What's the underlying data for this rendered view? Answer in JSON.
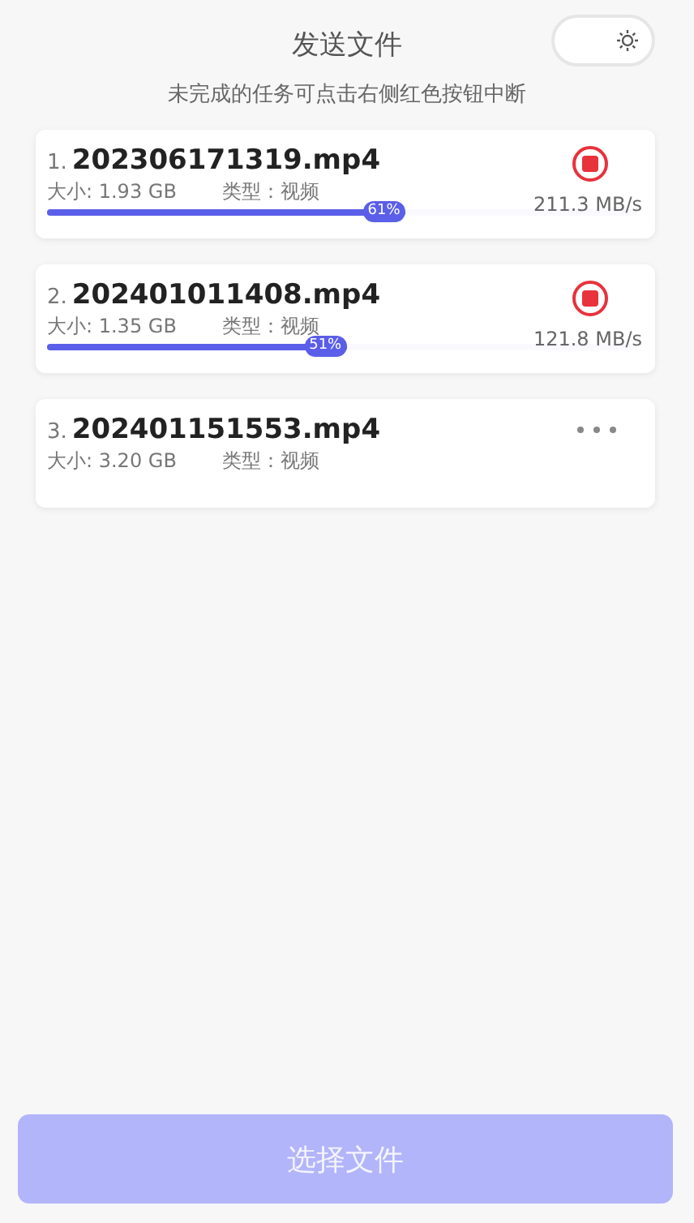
{
  "header": {
    "title": "发送文件",
    "hint": "未完成的任务可点击右侧红色按钮中断",
    "theme_toggle": {
      "on": false
    }
  },
  "files": [
    {
      "index": "1.",
      "name": "202306171319.mp4",
      "size": "大小: 1.93 GB",
      "type": "类型：视频",
      "kind": "sending",
      "level": 0.61,
      "percent": "61%",
      "speed": "211.3 MB/s"
    },
    {
      "index": "2.",
      "name": "202401011408.mp4",
      "size": "大小: 1.35 GB",
      "type": "类型：视频",
      "kind": "sending",
      "level": 0.51,
      "percent": "51%",
      "speed": "121.8 MB/s"
    },
    {
      "index": "3.",
      "name": "202401151553.mp4",
      "size": "大小: 3.20 GB",
      "type": "类型：视频",
      "kind": "waiting"
    }
  ],
  "select_button": {
    "label": "选择文件",
    "disabled": true
  }
}
